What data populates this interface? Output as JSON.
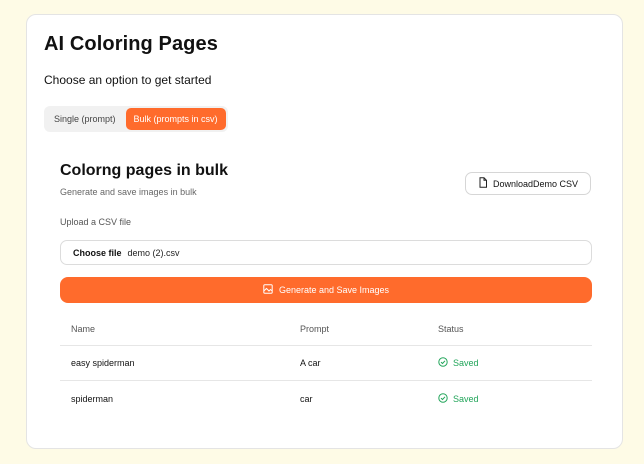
{
  "app": {
    "title": "AI Coloring Pages",
    "subtitle": "Choose an option to get started"
  },
  "mode_tabs": [
    {
      "label": "Single (prompt)",
      "active": false
    },
    {
      "label": "Bulk (prompts in csv)",
      "active": true
    }
  ],
  "bulk": {
    "title": "Colorng pages in bulk",
    "subtitle": "Generate and save images in bulk",
    "download_label": "DownloadDemo CSV",
    "upload_label": "Upload a CSV file",
    "choose_file_label": "Choose file",
    "file_name": "demo (2).csv",
    "generate_label": "Generate and Save Images"
  },
  "table": {
    "headers": [
      "Name",
      "Prompt",
      "Status"
    ],
    "rows": [
      {
        "name": "easy spiderman",
        "prompt": "A car",
        "status": "Saved"
      },
      {
        "name": "spiderman",
        "prompt": "car",
        "status": "Saved"
      }
    ]
  },
  "colors": {
    "accent": "#ff6b2c",
    "background": "#fefbe6",
    "success": "#22a55a"
  },
  "icons": {
    "download": "file-icon",
    "generate": "image-icon",
    "status": "check-circle-icon"
  }
}
